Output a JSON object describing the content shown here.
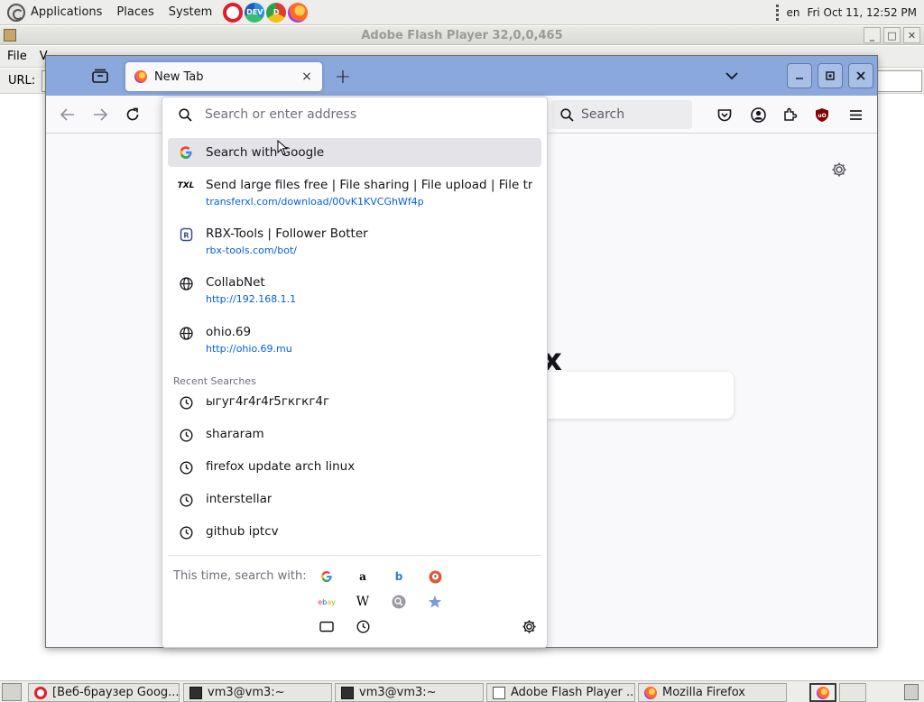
{
  "top_panel": {
    "menus": [
      "Applications",
      "Places",
      "System"
    ],
    "launchers": [
      "opera-icon",
      "edge-dev-icon",
      "chrome-dev-icon",
      "firefox-icon"
    ],
    "keyboard_layout": "en",
    "clock": "Fri Oct 11, 12:52 PM"
  },
  "flash_window": {
    "title": "Adobe Flash Player 32,0,0,465",
    "menu": [
      "File",
      "V"
    ],
    "url_label": "URL:"
  },
  "firefox": {
    "tab_title": "New Tab",
    "tab_close": "×",
    "new_tab": "+",
    "nav_search_placeholder": "Search",
    "content_brand_fragment": "x",
    "urlbar": {
      "placeholder": "Search or enter address",
      "results": [
        {
          "title": "Search with Google",
          "url": "",
          "icon": "google-icon",
          "selected": true
        },
        {
          "title": "Send large files free | File sharing | File upload | File transfer",
          "url": "transferxl.com/download/00vK1KVCGhWf4p",
          "icon": "txl-icon"
        },
        {
          "title": "RBX-Tools | Follower Botter",
          "url": "rbx-tools.com/bot/",
          "icon": "rbx-icon"
        },
        {
          "title": "CollabNet",
          "url": "http://192.168.1.1",
          "icon": "globe-icon"
        },
        {
          "title": "ohio.69",
          "url": "http://ohio.69.mu",
          "icon": "globe-icon"
        }
      ],
      "recent_label": "Recent Searches",
      "recent_searches": [
        "ыгуг4r4r4r5гкгкг4г",
        "shararam",
        "firefox update arch linux",
        "interstellar",
        "github iptcv"
      ],
      "oneoff_label": "This time, search with:",
      "engines": [
        "google",
        "amazon",
        "bing",
        "duckduckgo",
        "ebay",
        "wikipedia",
        "search-engine",
        "bookmarks"
      ]
    }
  },
  "taskbar": {
    "items": [
      "[Веб-браузер Goog...",
      "vm3@vm3:~",
      "vm3@vm3:~",
      "Adobe Flash Player ...",
      "Mozilla Firefox"
    ]
  }
}
